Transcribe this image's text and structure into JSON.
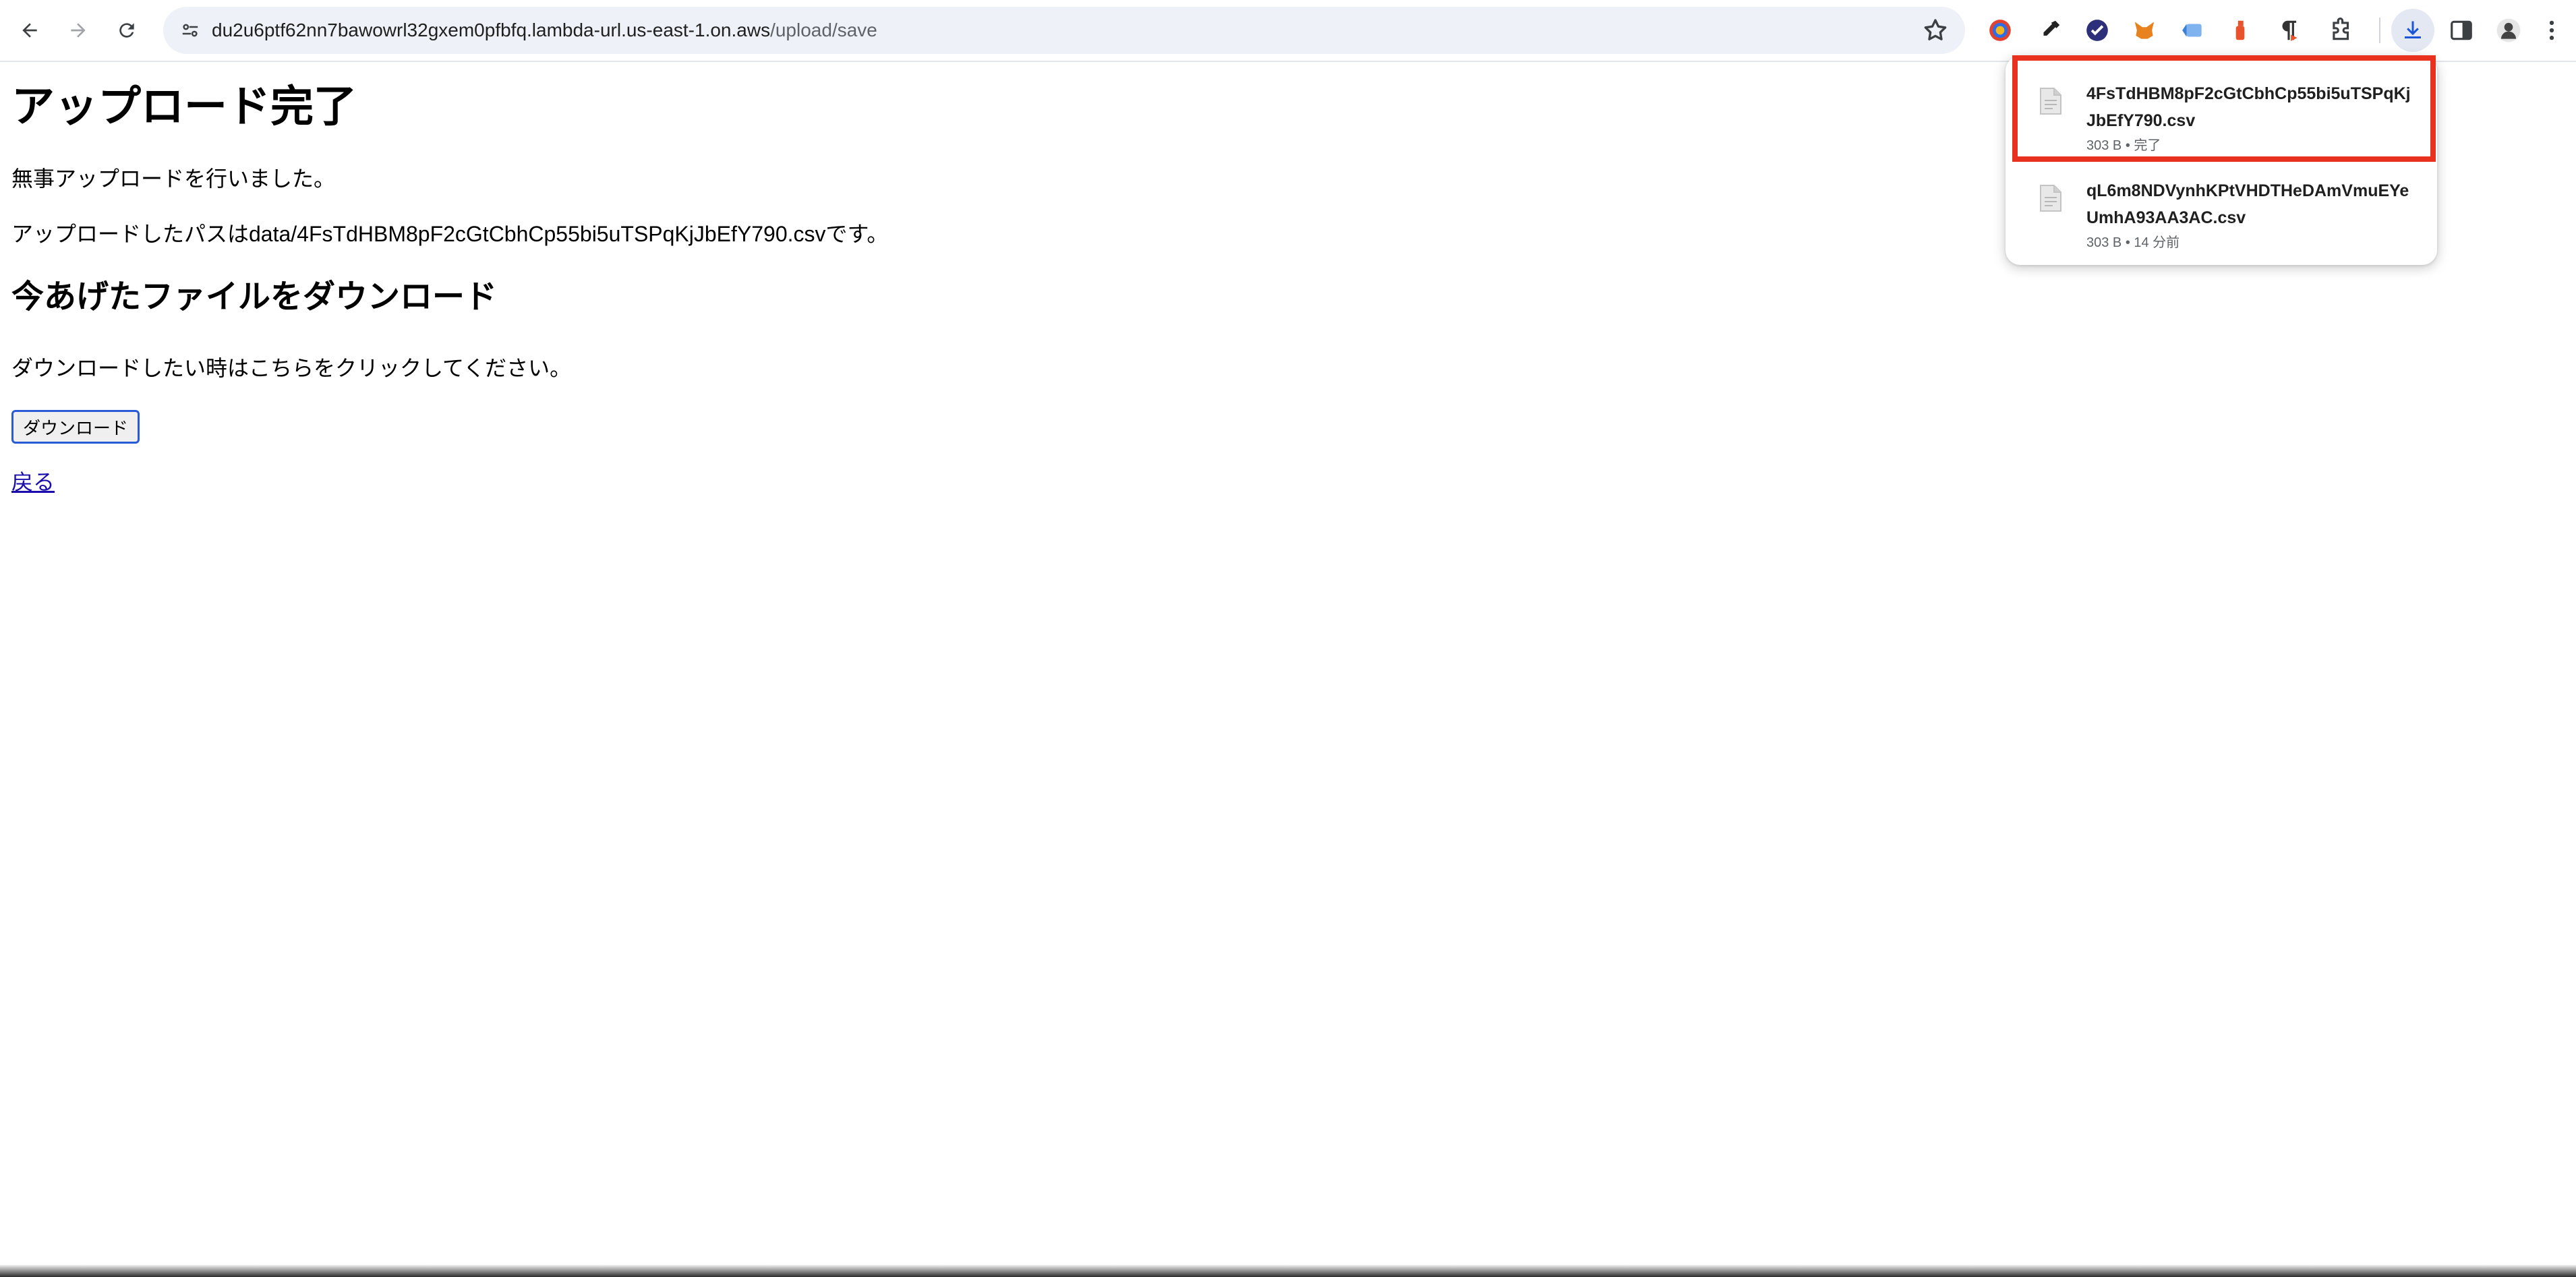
{
  "browser": {
    "url_host": "du2u6ptf62nn7bawowrl32gxem0pfbfq.lambda-url.us-east-1.on.aws",
    "url_path": "/upload/save"
  },
  "page": {
    "title": "アップロード完了",
    "message": "無事アップロードを行いました。",
    "path_text": "アップロードしたパスはdata/4FsTdHBM8pF2cGtCbhCp55bi5uTSPqKjJbEfY790.csvです。",
    "download_heading": "今あげたファイルをダウンロード",
    "download_text": "ダウンロードしたい時はこちらをクリックしてください。",
    "download_button": "ダウンロード",
    "back_link": "戻る"
  },
  "downloads": [
    {
      "name": "4FsTdHBM8pF2cGtCbhCp55bi5uTSPqKjJbEfY790.csv",
      "meta": "303 B • 完了"
    },
    {
      "name": "qL6m8NDVynhKPtVHDTHeDAmVmuEYeUmhA93AA3AC.csv",
      "meta": "303 B • 14 分前"
    }
  ],
  "colors": {
    "highlight": "#e8321f",
    "link": "#1a0dab",
    "button_border": "#2a5bd7"
  }
}
